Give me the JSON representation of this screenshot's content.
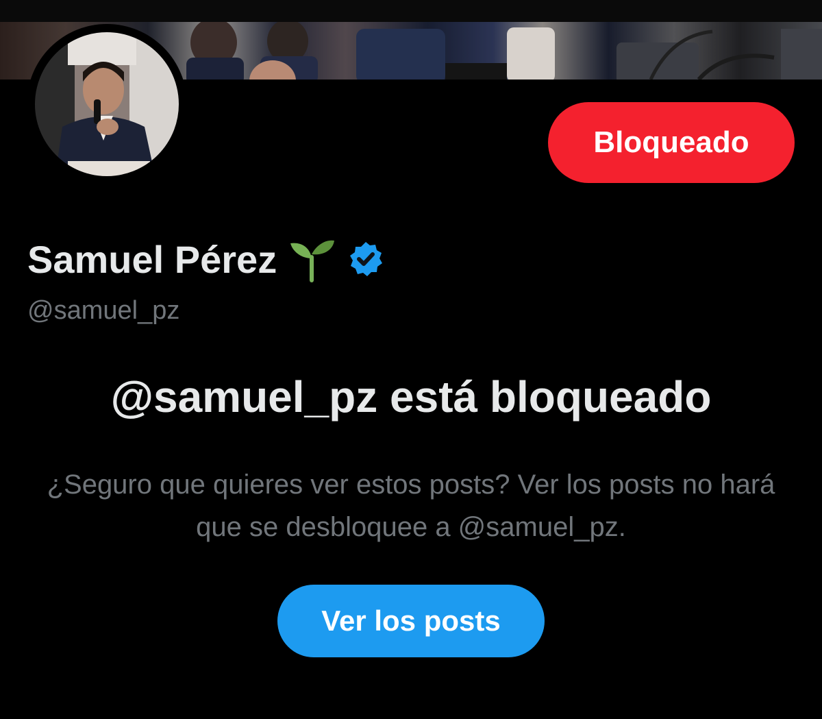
{
  "profile": {
    "display_name": "Samuel Pérez",
    "name_emoji_icon": "seedling-icon",
    "verified_icon": "verified-badge-icon",
    "handle": "@samuel_pz"
  },
  "actions": {
    "block_label": "Bloqueado",
    "view_posts_label": "Ver los posts"
  },
  "blocked_notice": {
    "title": "@samuel_pz está bloqueado",
    "description": "¿Seguro que quieres ver estos posts? Ver los posts no hará que se desbloquee a @samuel_pz."
  },
  "colors": {
    "background": "#000000",
    "block_button": "#f4212e",
    "view_button": "#1d9bf0",
    "verified": "#1d9bf0",
    "primary_text": "#e7e9ea",
    "secondary_text": "#71767b"
  }
}
